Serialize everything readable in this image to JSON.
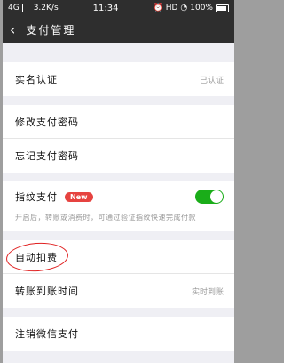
{
  "status_bar": {
    "network": "4G",
    "speed": "3.2K/s",
    "time": "11:34",
    "hd": "HD",
    "battery": "100%"
  },
  "nav": {
    "title": "支付管理"
  },
  "rows": {
    "real_name": {
      "label": "实名认证",
      "value": "已认证"
    },
    "change_pwd": {
      "label": "修改支付密码"
    },
    "forgot_pwd": {
      "label": "忘记支付密码"
    },
    "fingerprint": {
      "label": "指纹支付",
      "badge": "New",
      "hint": "开启后，转账或消费时，可通过验证指纹快速完成付款",
      "enabled": true
    },
    "auto_deduct": {
      "label": "自动扣费"
    },
    "transfer_time": {
      "label": "转账到账时间",
      "value": "实时到账"
    },
    "deregister": {
      "label": "注销微信支付"
    }
  },
  "colors": {
    "toggle_on": "#1aad19",
    "badge": "#e64340",
    "annotation": "#e02020"
  }
}
